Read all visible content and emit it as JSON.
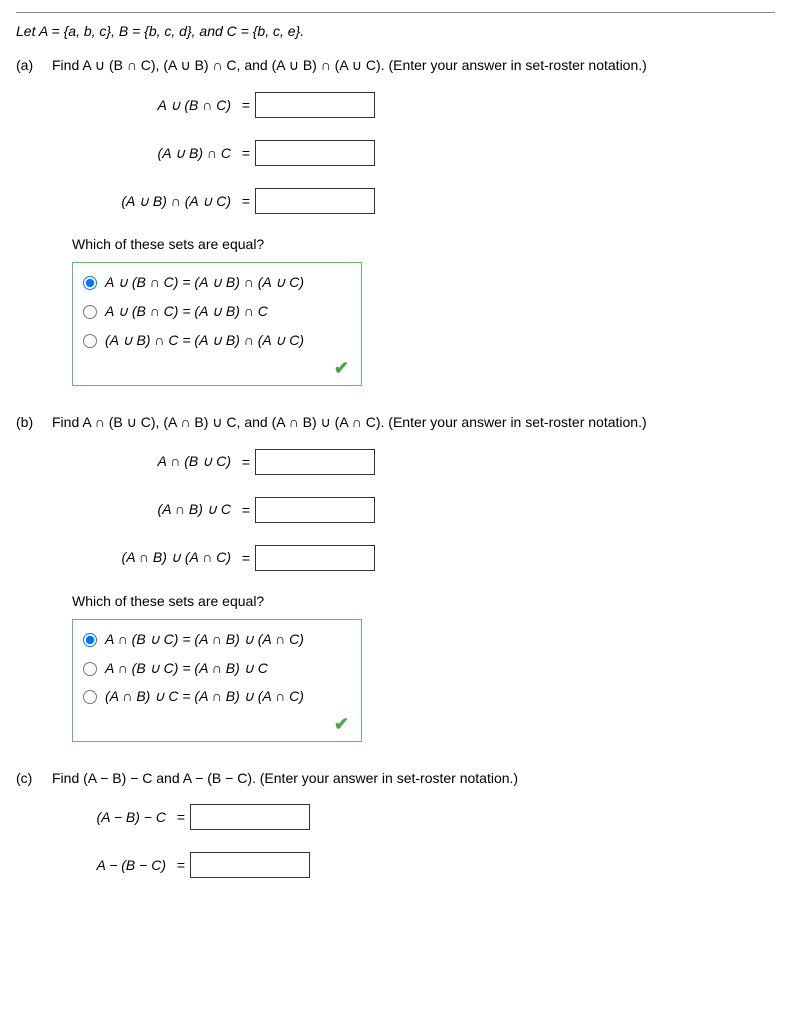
{
  "intro": "Let A = {a, b, c}, B = {b, c, d}, and C = {b, c, e}.",
  "parts": {
    "a": {
      "label": "(a)",
      "prompt": "Find A ∪ (B ∩ C), (A ∪ B) ∩ C, and (A ∪ B) ∩ (A ∪ C). (Enter your answer in set-roster notation.)",
      "eq1": "A ∪ (B ∩ C)",
      "eq2": "(A ∪ B) ∩ C",
      "eq3": "(A ∪ B) ∩ (A ∪ C)",
      "subq": "Which of these sets are equal?",
      "r1": "A ∪ (B ∩ C) = (A ∪ B) ∩ (A ∪ C)",
      "r2": "A ∪ (B ∩ C) = (A ∪ B) ∩ C",
      "r3": "(A ∪ B) ∩ C = (A ∪ B) ∩ (A ∪ C)"
    },
    "b": {
      "label": "(b)",
      "prompt": "Find A ∩ (B ∪ C), (A ∩ B) ∪ C, and (A ∩ B) ∪ (A ∩ C). (Enter your answer in set-roster notation.)",
      "eq1": "A ∩ (B ∪ C)",
      "eq2": "(A ∩ B) ∪ C",
      "eq3": "(A ∩ B) ∪ (A ∩ C)",
      "subq": "Which of these sets are equal?",
      "r1": "A ∩ (B ∪ C) = (A ∩ B) ∪ (A ∩ C)",
      "r2": "A ∩ (B ∪ C) = (A ∩ B) ∪ C",
      "r3": "(A ∩ B) ∪ C = (A ∩ B) ∪ (A ∩ C)"
    },
    "c": {
      "label": "(c)",
      "prompt": "Find (A − B) − C and A − (B − C). (Enter your answer in set-roster notation.)",
      "eq1": "(A − B) − C",
      "eq2": "A − (B − C)"
    }
  },
  "equals": "="
}
